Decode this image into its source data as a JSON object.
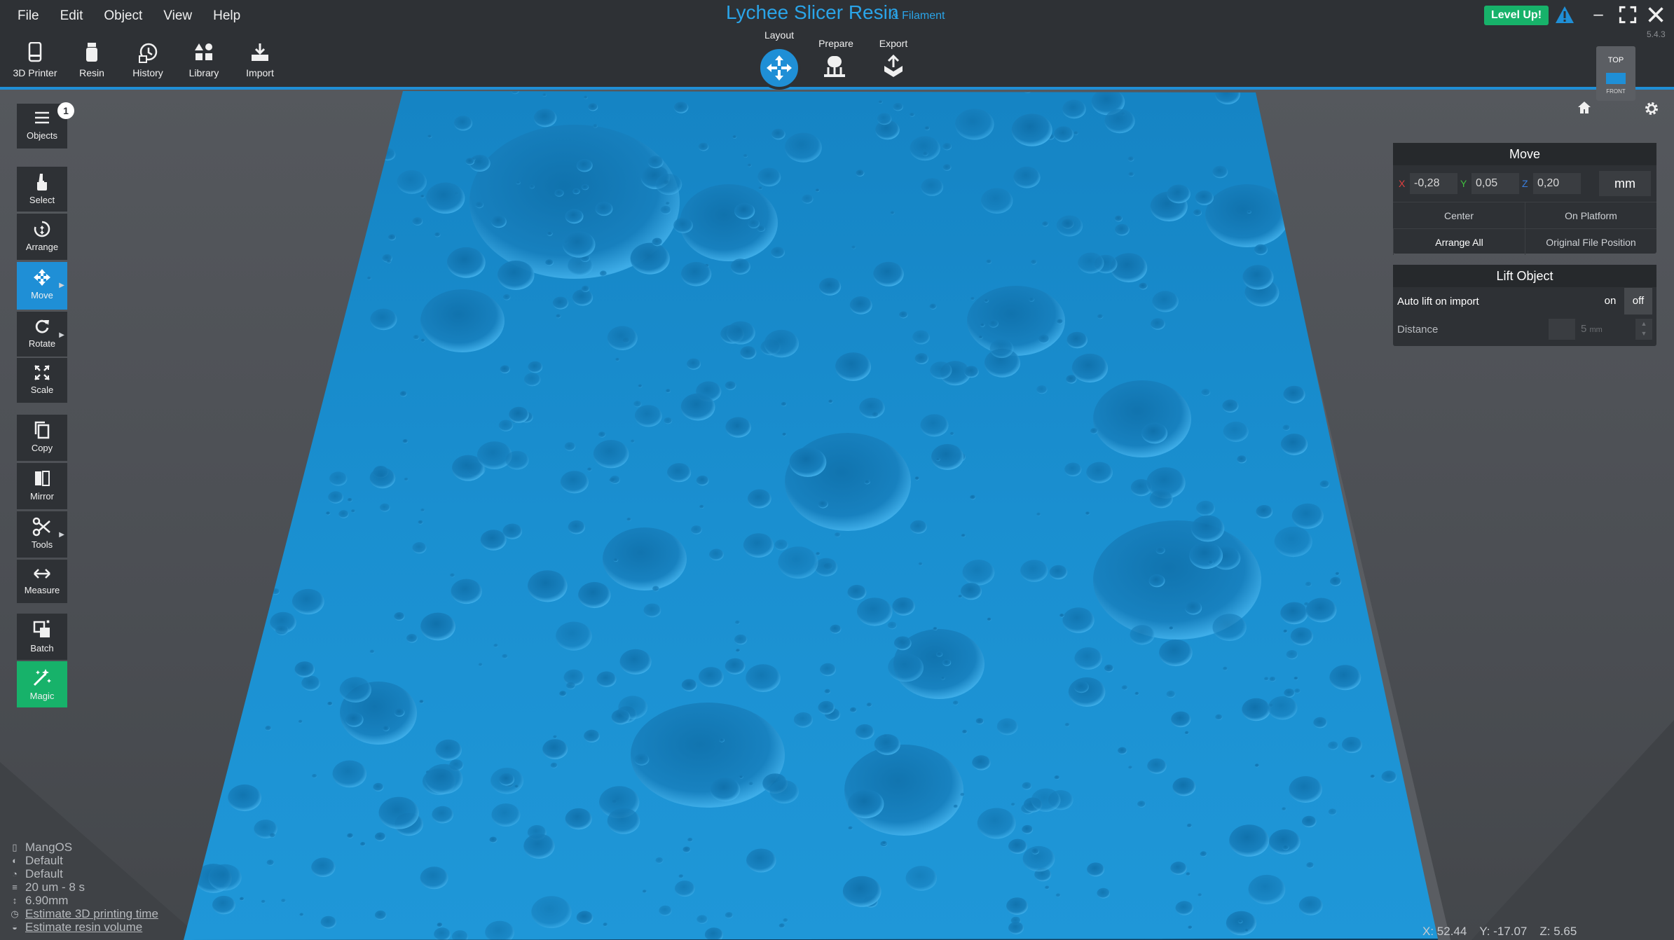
{
  "window": {
    "title": "Lychee Slicer Resin",
    "subtitle": "& Filament",
    "version": "5.4.3",
    "level_up": "Level Up!"
  },
  "menu": [
    "File",
    "Edit",
    "Object",
    "View",
    "Help"
  ],
  "top_tools": [
    {
      "label": "3D Printer",
      "icon": "printer-icon"
    },
    {
      "label": "Resin",
      "icon": "resin-bottle-icon"
    },
    {
      "label": "History",
      "icon": "history-icon"
    },
    {
      "label": "Library",
      "icon": "library-icon"
    },
    {
      "label": "Import",
      "icon": "import-icon"
    }
  ],
  "modes": {
    "layout": "Layout",
    "prepare": "Prepare",
    "export": "Export",
    "active": "Layout"
  },
  "left_tools": {
    "objects": "Objects",
    "objects_count": "1",
    "select": "Select",
    "arrange": "Arrange",
    "move": "Move",
    "rotate": "Rotate",
    "scale": "Scale",
    "copy": "Copy",
    "mirror": "Mirror",
    "tools": "Tools",
    "measure": "Measure",
    "batch": "Batch",
    "magic": "Magic"
  },
  "view_cube": {
    "top": "TOP",
    "front": "FRONT"
  },
  "move_panel": {
    "title": "Move",
    "x_label": "X",
    "x": "-0,28",
    "y_label": "Y",
    "y": "0,05",
    "z_label": "Z",
    "z": "0,20",
    "unit": "mm",
    "center": "Center",
    "on_platform": "On Platform",
    "arrange_all": "Arrange All",
    "original_position": "Original File Position"
  },
  "lift_panel": {
    "title": "Lift Object",
    "auto_lift": "Auto lift on import",
    "on": "on",
    "off": "off",
    "selected": "off",
    "distance_label": "Distance",
    "distance_value": "5",
    "distance_unit": "mm"
  },
  "info": {
    "printer": "MangOS",
    "resin1": "Default",
    "resin2": "Default",
    "layers": "20 um - 8 s",
    "height": "6.90mm",
    "estimate_time": "Estimate 3D printing time",
    "estimate_volume": "Estimate resin volume"
  },
  "cursor": {
    "x": "X: 52.44",
    "y": "Y: -17.07",
    "z": "Z: 5.65"
  },
  "colors": {
    "accent": "#1f8fd6",
    "model": "#1a8fd0",
    "green": "#17b26a",
    "toolbar": "#2e3135"
  }
}
